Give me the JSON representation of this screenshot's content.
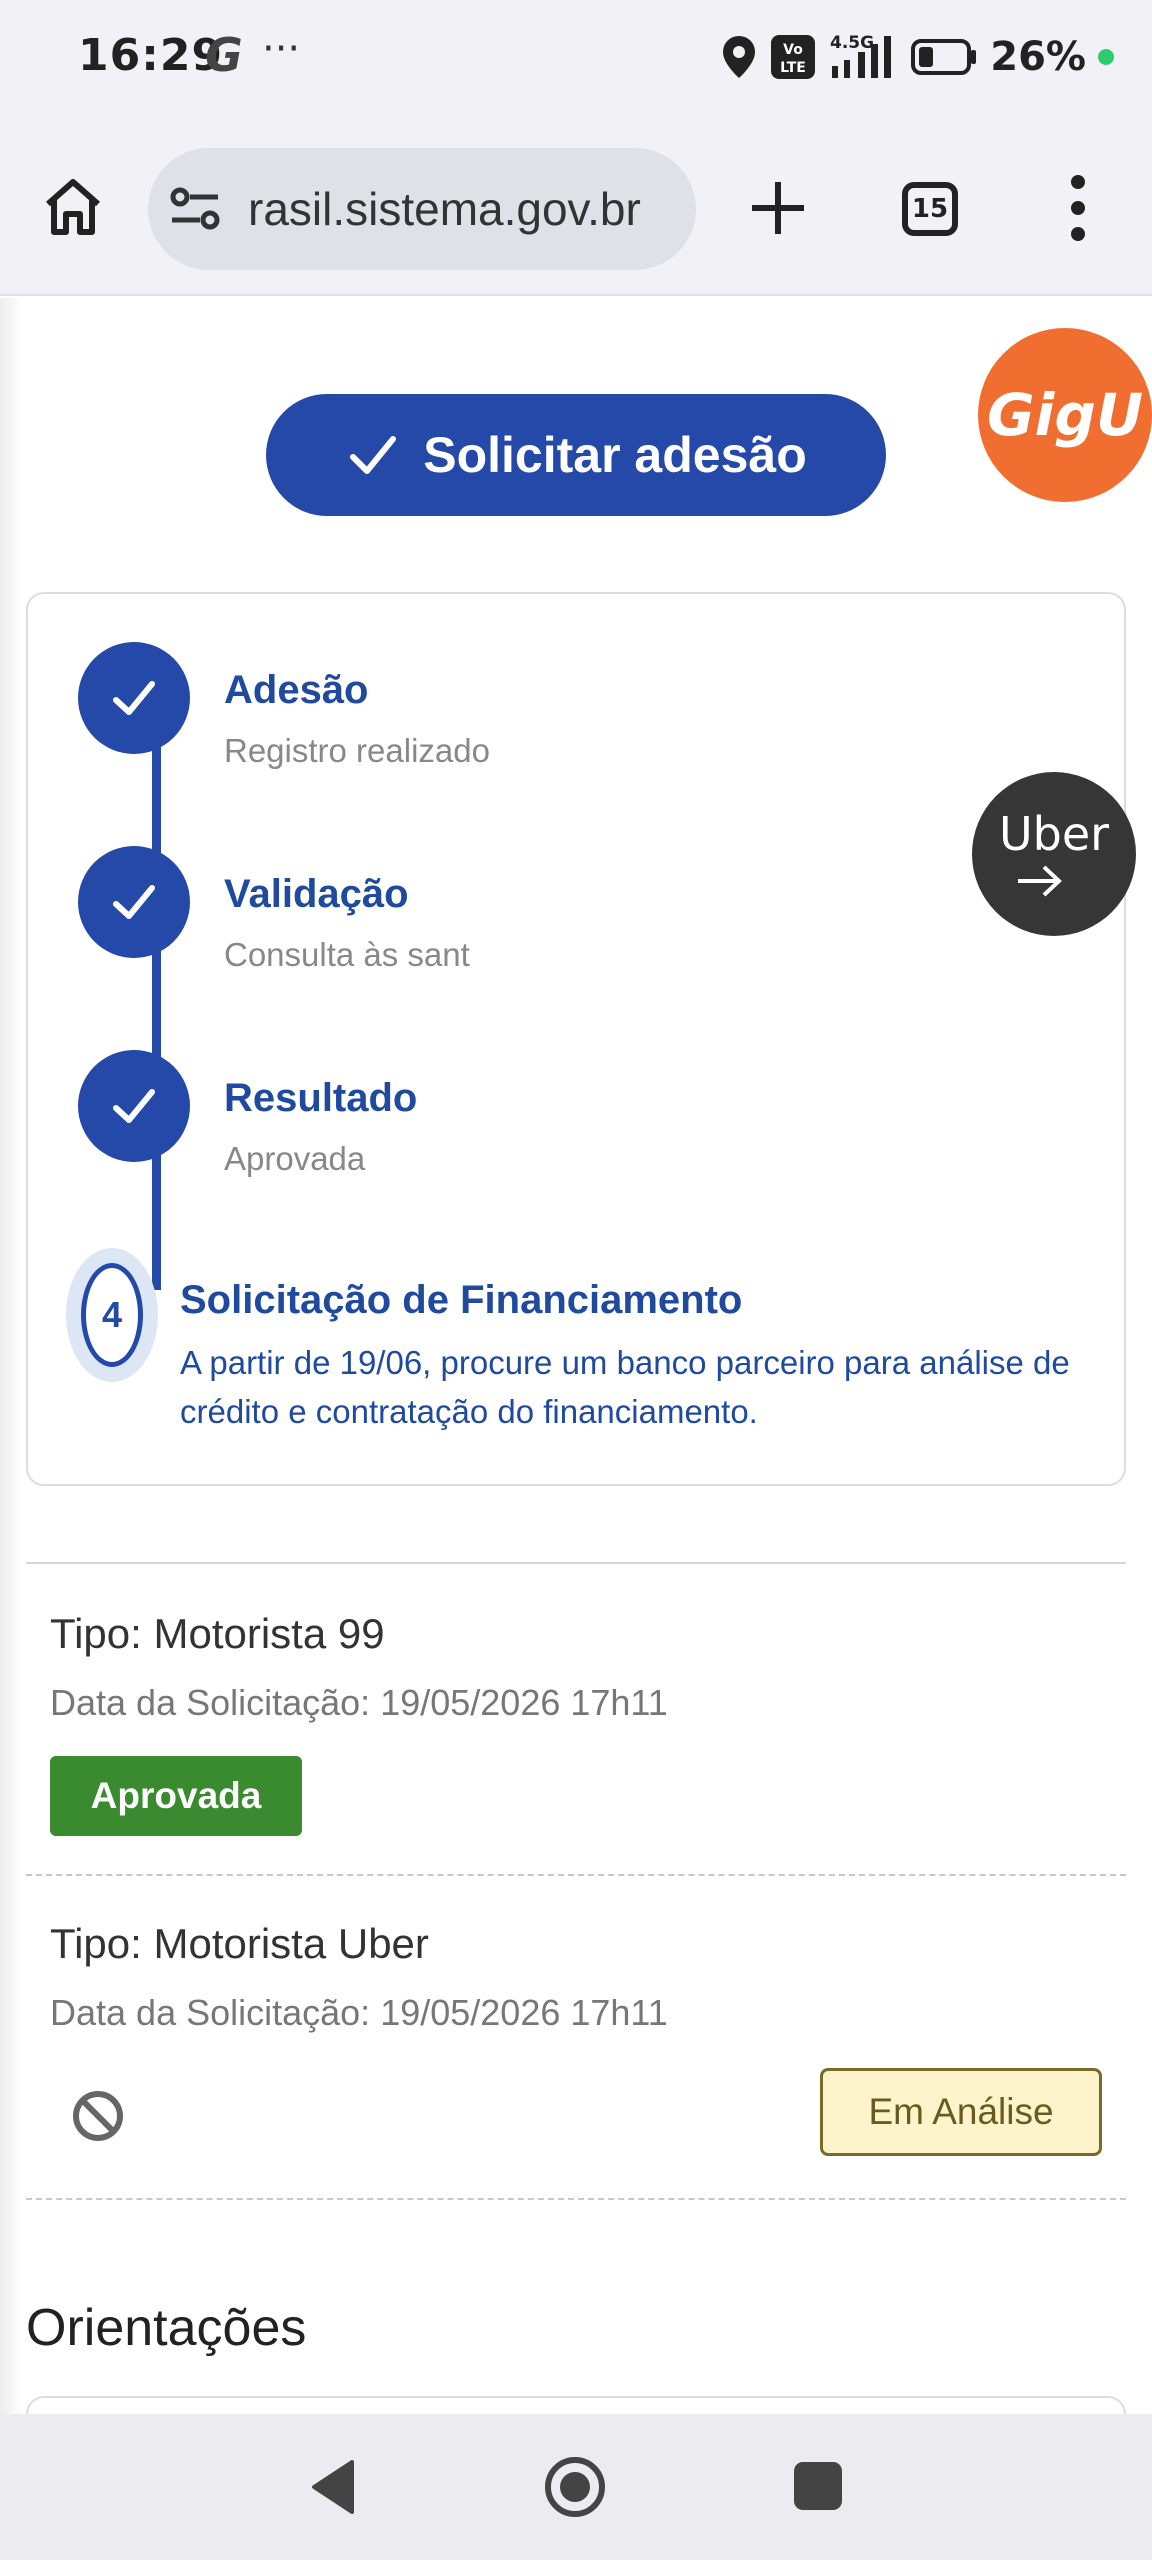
{
  "status_bar": {
    "time": "16:29",
    "g_indicator": "G",
    "more_dots": "···",
    "battery_percent": "26%",
    "network_label": "4.5G",
    "icons": [
      "location-icon",
      "volte-icon",
      "signal-icon",
      "battery-icon"
    ]
  },
  "browser": {
    "url": "rasil.sistema.gov.br",
    "tab_count": "15"
  },
  "page": {
    "cta_label": "Solicitar adesão",
    "gigu_label": "GigU",
    "uber_label": "Uber",
    "steps": [
      {
        "title": "Adesão",
        "subtitle": "Registro realizado"
      },
      {
        "title": "Validação",
        "subtitle": "Consulta às sant"
      },
      {
        "title": "Resultado",
        "subtitle": "Aprovada"
      }
    ],
    "step4": {
      "number": "4",
      "title": "Solicitação de Financiamento",
      "description": "A partir de 19/06, procure um banco parceiro para análise de crédito e contratação do financiamento."
    },
    "requests": [
      {
        "tipo": "Tipo: Motorista 99",
        "data": "Data da Solicitação: 19/05/2026 17h11",
        "status": "Aprovada"
      },
      {
        "tipo": "Tipo: Motorista Uber",
        "data": "Data da Solicitação: 19/05/2026 17h11",
        "status": "Em Análise"
      }
    ],
    "section_title": "Orientações"
  },
  "colors": {
    "primary_blue": "#2549a8",
    "approved_green": "#3a8a30",
    "analysis_yellow": "#fdf4cc",
    "gigu_orange": "#ef6e30",
    "uber_dark": "#363636"
  }
}
